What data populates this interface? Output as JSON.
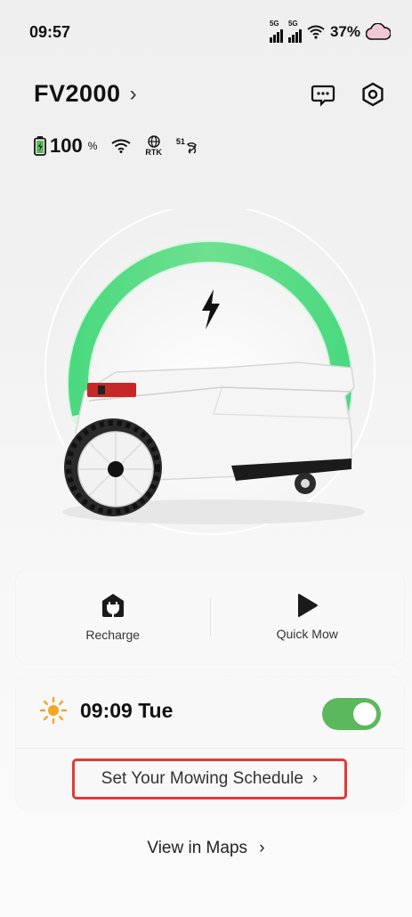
{
  "status_bar": {
    "time": "09:57",
    "net1": "5G",
    "net2": "5G",
    "battery": "37%"
  },
  "header": {
    "device_name": "FV2000",
    "chevron": "›"
  },
  "stats": {
    "battery_value": "100",
    "battery_unit": "%",
    "rtk_label": "RTK",
    "satellites": "51"
  },
  "actions": {
    "recharge": "Recharge",
    "quick_mow": "Quick Mow"
  },
  "schedule": {
    "time": "09:09 Tue",
    "enabled": true,
    "link_label": "Set Your Mowing Schedule",
    "link_chevron": "›"
  },
  "maps": {
    "label": "View in Maps",
    "chevron": "›"
  },
  "colors": {
    "accent_green": "#5cb85c",
    "highlight_red": "#e53935"
  }
}
